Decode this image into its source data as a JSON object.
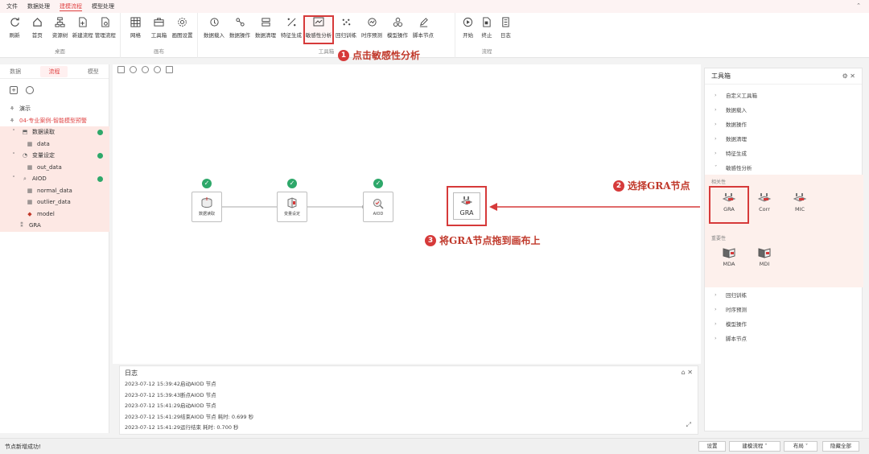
{
  "menu": {
    "items": [
      "文件",
      "数据处理",
      "建模流程",
      "模型处理"
    ],
    "active_index": 2
  },
  "ribbon": {
    "groups": [
      {
        "title": "桌面",
        "buttons": [
          "刷新",
          "首页",
          "资源树",
          "新建流程",
          "管理流程"
        ]
      },
      {
        "title": "画布",
        "buttons": [
          "网格",
          "工具箱",
          "画图设置"
        ]
      },
      {
        "title": "工具箱",
        "buttons": [
          "数据载入",
          "数据操作",
          "数据清理",
          "特征生成",
          "敏感性分析",
          "回归训练",
          "时序预测",
          "模型操作",
          "脚本节点"
        ]
      },
      {
        "title": "流程",
        "buttons": [
          "开始",
          "终止",
          "日志"
        ]
      }
    ]
  },
  "left_panel": {
    "tabs": [
      "数据",
      "流程",
      "模型"
    ],
    "active_tab": 1,
    "tree": {
      "root": "演示",
      "project": "04-专业案例-智能模型预警",
      "items": [
        {
          "label": "数据读取",
          "ok": true,
          "children": [
            "data"
          ]
        },
        {
          "label": "变量设定",
          "ok": true,
          "children": [
            "out_data"
          ]
        },
        {
          "label": "AIOD",
          "ok": true,
          "children": [
            "normal_data",
            "outlier_data",
            "model"
          ]
        },
        {
          "label": "GRA",
          "ok": false,
          "children": []
        }
      ]
    }
  },
  "canvas": {
    "nodes": [
      {
        "label": "数据读取"
      },
      {
        "label": "变量设定"
      },
      {
        "label": "AIOD"
      },
      {
        "label": "GRA"
      }
    ]
  },
  "annotations": {
    "step1": {
      "num": "1",
      "text": "点击敏感性分析"
    },
    "step2": {
      "num": "2",
      "text": "选择GRA节点"
    },
    "step3": {
      "num": "3",
      "text": "将GRA节点拖到画布上"
    }
  },
  "log": {
    "title": "日志",
    "lines": [
      "2023-07-12 15:39:42启动AIOD 节点",
      "2023-07-12 15:39:43断点AIOD 节点",
      "2023-07-12 15:41:29启动AIOD 节点",
      "2023-07-12 15:41:29结束AIOD 节点 耗时:  0.699 秒",
      "2023-07-12 15:41:29运行结束 耗时:  0.700 秒"
    ]
  },
  "toolbox": {
    "title": "工具箱",
    "rows_before": [
      "自定义工具箱",
      "数据载入",
      "数据操作",
      "数据清理",
      "特征生成",
      "敏感性分析"
    ],
    "sections": {
      "correlation": {
        "label": "相关性",
        "tools": [
          "GRA",
          "Corr",
          "MIC"
        ]
      },
      "importance": {
        "label": "重要性",
        "tools": [
          "MDA",
          "MDI"
        ]
      }
    },
    "rows_after": [
      "回归训练",
      "时序预测",
      "模型操作",
      "脚本节点"
    ]
  },
  "status": {
    "message": "节点新增成功!",
    "buttons": [
      "设置",
      "建模流程",
      "布局",
      "隐藏全部"
    ]
  },
  "colors": {
    "accent": "#e04646",
    "ok": "#2ea86a",
    "highlight": "#d63a3a"
  }
}
